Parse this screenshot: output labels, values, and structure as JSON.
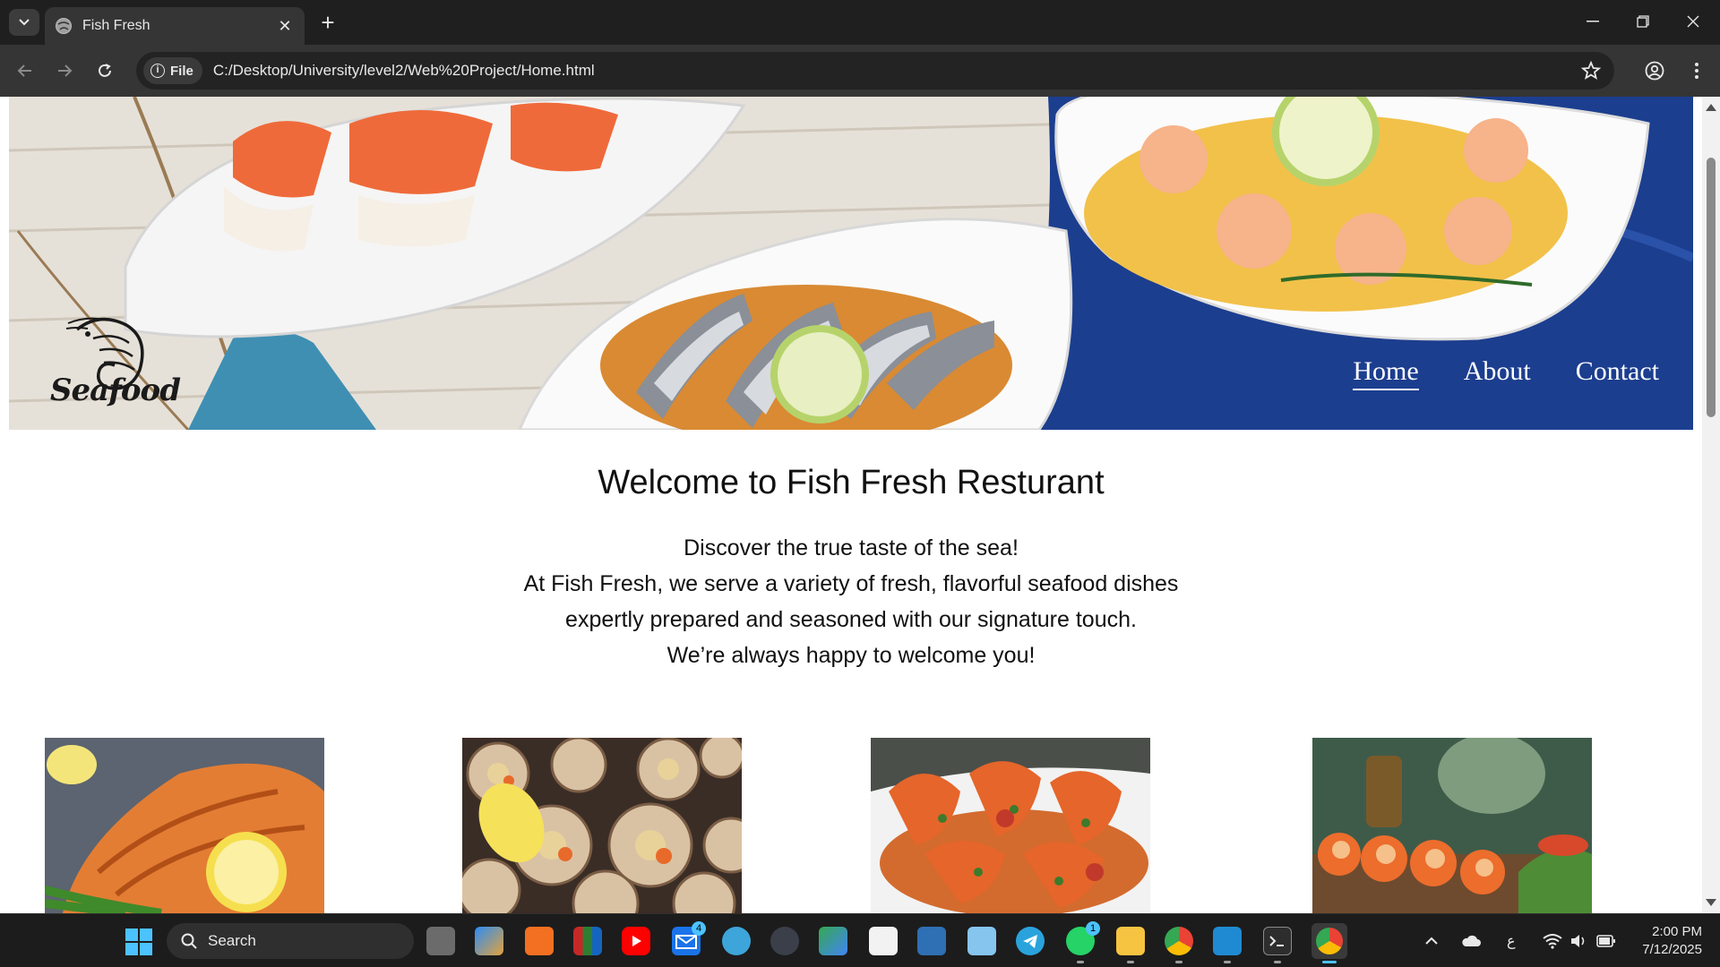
{
  "browser": {
    "tab_title": "Fish Fresh",
    "url_chip": "File",
    "url": "C:/Desktop/University/level2/Web%20Project/Home.html"
  },
  "page": {
    "logo_text": "Seafood",
    "nav": [
      {
        "label": "Home",
        "active": true
      },
      {
        "label": "About",
        "active": false
      },
      {
        "label": "Contact",
        "active": false
      }
    ],
    "welcome_title": "Welcome to Fish Fresh Resturant",
    "intro_lines": [
      "Discover the true taste of the sea!",
      "At Fish Fresh, we serve a variety of fresh, flavorful seafood dishes",
      "expertly prepared and seasoned with our signature touch.",
      "We’re always happy to welcome you!"
    ]
  },
  "taskbar": {
    "search_label": "Search",
    "mail_badge": "4",
    "whatsapp_badge": "1",
    "keyboard_lang": "ع",
    "time": "2:00 PM",
    "date": "7/12/2025"
  },
  "colors": {
    "nav_text": "#ffffff",
    "hero_cloth": "#1c3e8f",
    "browser_frame": "#1f1f1f"
  }
}
